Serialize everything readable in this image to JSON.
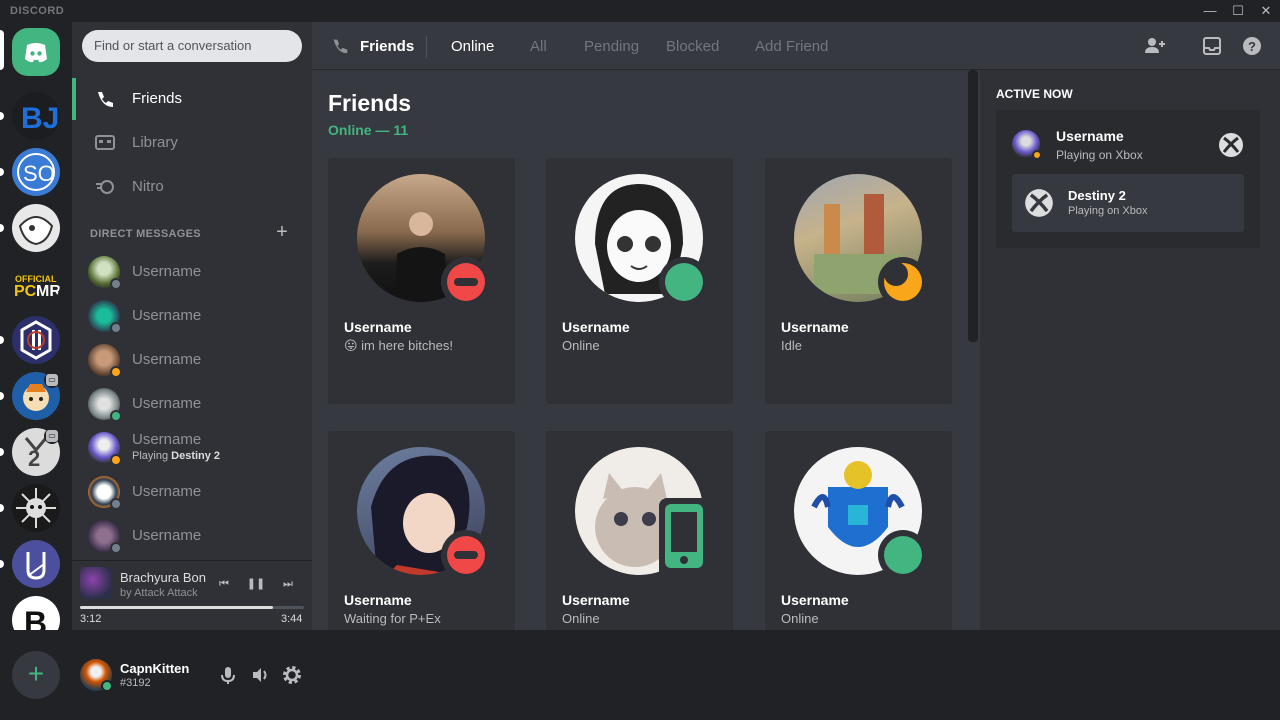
{
  "app": {
    "brand": "DISCORD"
  },
  "colors": {
    "online": "#43b581",
    "idle": "#faa61a",
    "dnd": "#f04747",
    "accent": "#7289da"
  },
  "search": {
    "placeholder": "Find or start a conversation"
  },
  "nav": [
    {
      "label": "Friends",
      "icon": "friends-icon"
    },
    {
      "label": "Library",
      "icon": "library-icon"
    },
    {
      "label": "Nitro",
      "icon": "nitro-icon"
    }
  ],
  "dm_header": "DIRECT MESSAGES",
  "dms": [
    {
      "name": "Username",
      "status": "offline"
    },
    {
      "name": "Username",
      "status": "offline"
    },
    {
      "name": "Username",
      "status": "idle"
    },
    {
      "name": "Username",
      "status": "online"
    },
    {
      "name": "Username",
      "status": "idle",
      "sub_prefix": "Playing",
      "sub_game": "Destiny 2"
    },
    {
      "name": "Username",
      "status": "offline"
    },
    {
      "name": "Username",
      "status": "offline"
    }
  ],
  "player": {
    "title": "Brachyura Bon",
    "artist": "by Attack Attack",
    "elapsed": "3:12",
    "total": "3:44",
    "progress": 0.86
  },
  "user": {
    "name": "CapnKitten",
    "tag": "#3192"
  },
  "header": {
    "title": "Friends",
    "tabs": [
      "Online",
      "All",
      "Pending",
      "Blocked",
      "Add Friend"
    ],
    "active_tab": "Online"
  },
  "main": {
    "title": "Friends",
    "online_count": "Online — 11",
    "friends": [
      {
        "name": "Username",
        "status_text": "😛 im here bitches!",
        "status": "dnd"
      },
      {
        "name": "Username",
        "status_text": "Online",
        "status": "online"
      },
      {
        "name": "Username",
        "status_text": "Idle",
        "status": "idle"
      },
      {
        "name": "Username",
        "status_text": "Waiting for P+Ex",
        "status": "dnd"
      },
      {
        "name": "Username",
        "status_text": "Online",
        "status": "mobile"
      },
      {
        "name": "Username",
        "status_text": "Online",
        "status": "online"
      }
    ]
  },
  "active_now": {
    "title": "ACTIVE NOW",
    "name": "Username",
    "activity": "Playing on Xbox",
    "game": "Destiny 2",
    "game_sub": "Playing on Xbox"
  }
}
